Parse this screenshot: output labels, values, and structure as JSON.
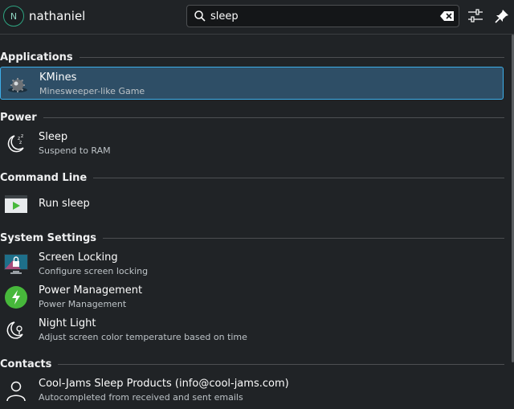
{
  "header": {
    "avatar_initial": "N",
    "username": "nathaniel",
    "search_value": "sleep",
    "icons": {
      "search": "search-icon",
      "clear": "backspace-clear-icon",
      "config": "sliders-config-icon",
      "pin": "pin-icon"
    }
  },
  "sections": {
    "applications": {
      "title": "Applications",
      "items": [
        {
          "title": "KMines",
          "subtitle": "Minesweeper-like Game",
          "icon": "kmines-icon",
          "selected": true
        }
      ]
    },
    "power": {
      "title": "Power",
      "items": [
        {
          "title": "Sleep",
          "subtitle": "Suspend to RAM",
          "icon": "moon-sleep-icon"
        }
      ]
    },
    "command_line": {
      "title": "Command Line",
      "items": [
        {
          "title": "Run sleep",
          "icon": "terminal-run-icon"
        }
      ]
    },
    "system_settings": {
      "title": "System Settings",
      "items": [
        {
          "title": "Screen Locking",
          "subtitle": "Configure screen locking",
          "icon": "screen-lock-icon"
        },
        {
          "title": "Power Management",
          "subtitle": "Power Management",
          "icon": "power-management-icon"
        },
        {
          "title": "Night Light",
          "subtitle": "Adjust screen color temperature based on time",
          "icon": "night-light-icon"
        }
      ]
    },
    "contacts": {
      "title": "Contacts",
      "items": [
        {
          "title": "Cool-Jams Sleep Products (info@cool-jams.com)",
          "subtitle": "Autocompleted from received and sent emails",
          "icon": "person-icon"
        }
      ]
    }
  },
  "colors": {
    "background": "#202326",
    "accent": "#3daee9",
    "selection": "#2e4e66",
    "power_green": "#47b83b"
  }
}
